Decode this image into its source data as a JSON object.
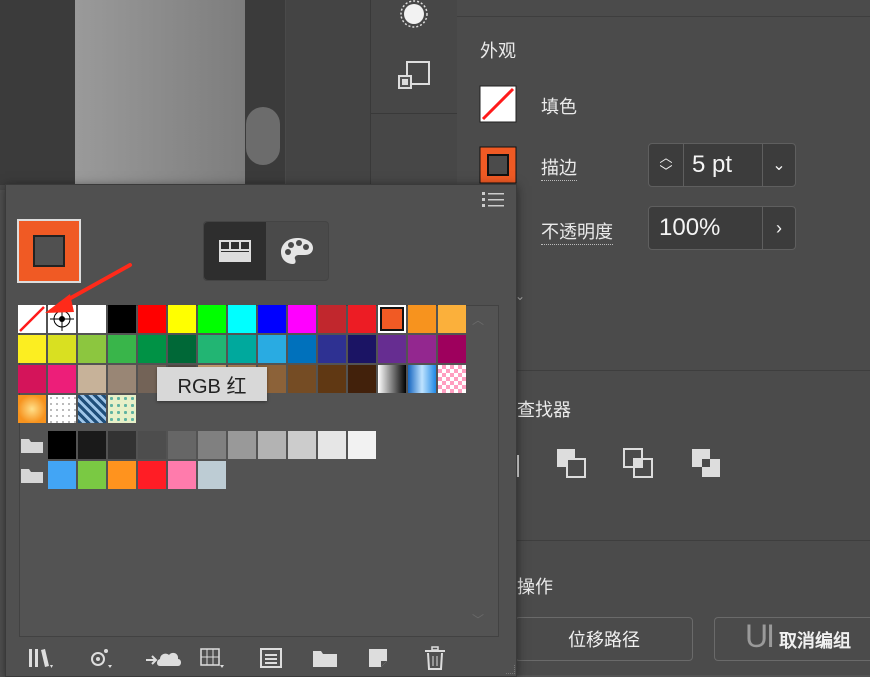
{
  "appearance": {
    "section_title": "外观",
    "fill_label": "填色",
    "stroke_label": "描边",
    "stroke_weight": "5 pt",
    "opacity_label": "不透明度",
    "opacity_value": "100%"
  },
  "pathfinder": {
    "section_title": "查找器"
  },
  "quick_actions": {
    "section_title": "操作",
    "offset_path_button": "位移路径",
    "ungroup_button": "取消编组"
  },
  "swatches": {
    "tooltip": "RGB 红",
    "rows": [
      [
        "none",
        "registration",
        "#ffffff",
        "#000000",
        "#ff0000",
        "#ffff00",
        "#00ff00",
        "#00ffff",
        "#0000ff",
        "#ff00ff",
        "#c1272d",
        "#ed1c24",
        "#f15a24",
        "#f7931e",
        "#fbb03b"
      ],
      [
        "#fcee21",
        "#d9e021",
        "#8cc63f",
        "#39b54a",
        "#009245",
        "#006837",
        "#22b573",
        "#00a99d",
        "#29abe2",
        "#0071bc",
        "#2e3192",
        "#1b1464",
        "#662d91",
        "#93278f",
        "#9e005d"
      ],
      [
        "#d4145a",
        "#ed1e79",
        "#c7b299",
        "#998675",
        "#736357",
        "#534741",
        "#c69c6d",
        "#a67c52",
        "#8c6239",
        "#754c24",
        "#603813",
        "#42210b",
        "grad-bw",
        "grad-blue",
        "pattern-check"
      ],
      [
        "grad-orange",
        "pattern-dots",
        "pattern-blue",
        "pattern-green"
      ],
      [
        "folder",
        "#000000",
        "#1a1a1a",
        "#333333",
        "#4d4d4d",
        "#666666",
        "#808080",
        "#999999",
        "#b3b3b3",
        "#cccccc",
        "#e6e6e6",
        "#f2f2f2"
      ],
      [
        "folder",
        "#42a5f5",
        "#7ac943",
        "#ff931e",
        "#ff1d25",
        "#ff7bac",
        "#bdccd4"
      ]
    ]
  },
  "watermark": "UI",
  "colors": {
    "accent_orange": "#f05a24",
    "panel_bg": "#4b4b4b",
    "arrow_red": "#ff2a1a"
  },
  "icons": [
    "library-icon",
    "swatch-options-icon",
    "cloud-upload-icon",
    "view-grid-icon",
    "list-view-icon",
    "new-folder-icon",
    "new-swatch-icon",
    "delete-icon",
    "panel-menu-icon",
    "grid-thumbnail-icon",
    "color-palette-icon"
  ]
}
